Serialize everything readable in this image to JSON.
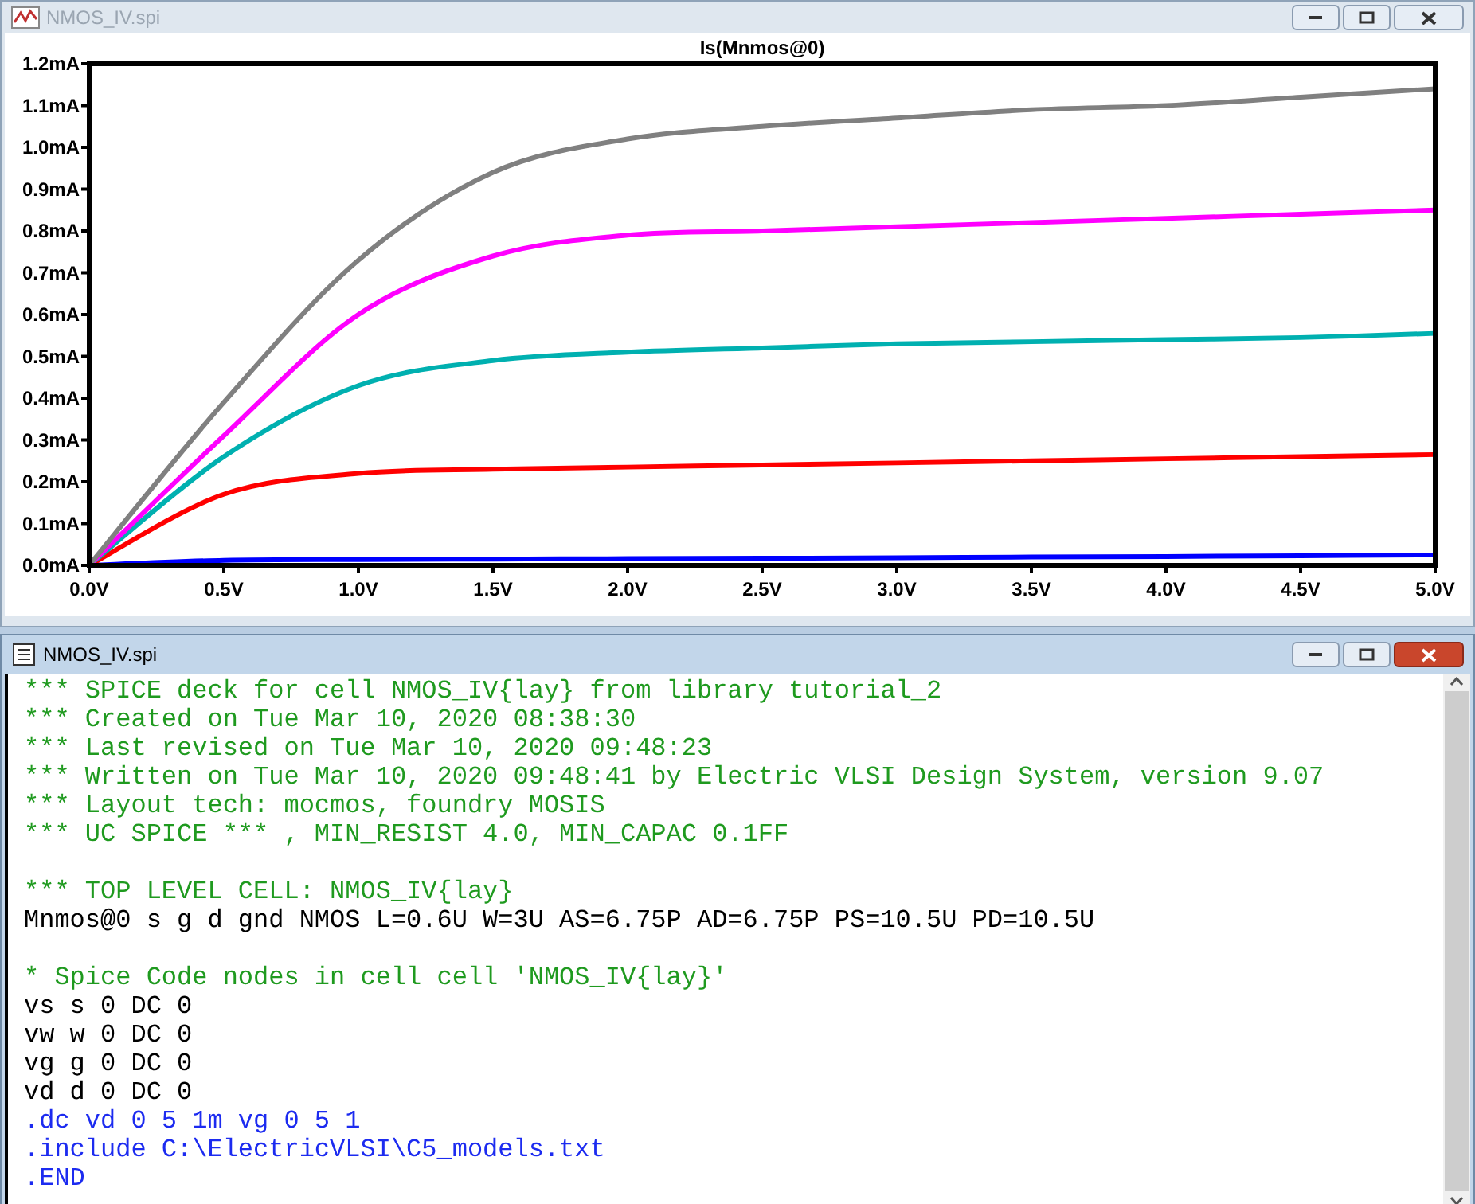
{
  "plot_window": {
    "title": "NMOS_IV.spi",
    "active": false,
    "chart_data": {
      "type": "line",
      "title": "Is(Mnmos@0)",
      "x": [
        0,
        0.5,
        1,
        1.5,
        2,
        2.5,
        3,
        3.5,
        4,
        4.5,
        5
      ],
      "xlim": [
        0,
        5
      ],
      "ylim": [
        0,
        1.2
      ],
      "xticks": [
        {
          "value": 0,
          "label": "0.0V"
        },
        {
          "value": 0.5,
          "label": "0.5V"
        },
        {
          "value": 1,
          "label": "1.0V"
        },
        {
          "value": 1.5,
          "label": "1.5V"
        },
        {
          "value": 2,
          "label": "2.0V"
        },
        {
          "value": 2.5,
          "label": "2.5V"
        },
        {
          "value": 3,
          "label": "3.0V"
        },
        {
          "value": 3.5,
          "label": "3.5V"
        },
        {
          "value": 4,
          "label": "4.0V"
        },
        {
          "value": 4.5,
          "label": "4.5V"
        },
        {
          "value": 5,
          "label": "5.0V"
        }
      ],
      "yticks": [
        {
          "value": 0,
          "label": "0.0mA"
        },
        {
          "value": 0.1,
          "label": "0.1mA"
        },
        {
          "value": 0.2,
          "label": "0.2mA"
        },
        {
          "value": 0.3,
          "label": "0.3mA"
        },
        {
          "value": 0.4,
          "label": "0.4mA"
        },
        {
          "value": 0.5,
          "label": "0.5mA"
        },
        {
          "value": 0.6,
          "label": "0.6mA"
        },
        {
          "value": 0.7,
          "label": "0.7mA"
        },
        {
          "value": 0.8,
          "label": "0.8mA"
        },
        {
          "value": 0.9,
          "label": "0.9mA"
        },
        {
          "value": 1.0,
          "label": "1.0mA"
        },
        {
          "value": 1.1,
          "label": "1.1mA"
        },
        {
          "value": 1.2,
          "label": "1.2mA"
        }
      ],
      "series": [
        {
          "color": "#0000ff",
          "values": [
            0,
            0.012,
            0.014,
            0.015,
            0.016,
            0.017,
            0.018,
            0.02,
            0.021,
            0.023,
            0.025
          ]
        },
        {
          "color": "#ff0000",
          "values": [
            0,
            0.17,
            0.22,
            0.23,
            0.235,
            0.24,
            0.245,
            0.25,
            0.255,
            0.26,
            0.265
          ]
        },
        {
          "color": "#00b0b0",
          "values": [
            0,
            0.26,
            0.43,
            0.49,
            0.51,
            0.52,
            0.53,
            0.535,
            0.54,
            0.545,
            0.555
          ]
        },
        {
          "color": "#ff00ff",
          "values": [
            0,
            0.31,
            0.6,
            0.74,
            0.79,
            0.8,
            0.81,
            0.82,
            0.83,
            0.84,
            0.85
          ]
        },
        {
          "color": "#808080",
          "values": [
            0,
            0.39,
            0.73,
            0.94,
            1.02,
            1.05,
            1.07,
            1.09,
            1.1,
            1.12,
            1.14
          ]
        }
      ]
    }
  },
  "text_window": {
    "title": "NMOS_IV.spi",
    "active": true,
    "lines": [
      {
        "kind": "comment",
        "text": "*** SPICE deck for cell NMOS_IV{lay} from library tutorial_2"
      },
      {
        "kind": "comment",
        "text": "*** Created on Tue Mar 10, 2020 08:38:30"
      },
      {
        "kind": "comment",
        "text": "*** Last revised on Tue Mar 10, 2020 09:48:23"
      },
      {
        "kind": "comment",
        "text": "*** Written on Tue Mar 10, 2020 09:48:41 by Electric VLSI Design System, version 9.07"
      },
      {
        "kind": "comment",
        "text": "*** Layout tech: mocmos, foundry MOSIS"
      },
      {
        "kind": "comment",
        "text": "*** UC SPICE *** , MIN_RESIST 4.0, MIN_CAPAC 0.1FF"
      },
      {
        "kind": "blank"
      },
      {
        "kind": "comment",
        "text": "*** TOP LEVEL CELL: NMOS_IV{lay}"
      },
      {
        "kind": "netlist",
        "text": "Mnmos@0 s g d gnd NMOS L=0.6U W=3U AS=6.75P AD=6.75P PS=10.5U PD=10.5U"
      },
      {
        "kind": "blank"
      },
      {
        "kind": "comment",
        "text": "* Spice Code nodes in cell cell 'NMOS_IV{lay}'"
      },
      {
        "kind": "netlist",
        "text": "vs s 0 DC 0"
      },
      {
        "kind": "netlist",
        "text": "vw w 0 DC 0"
      },
      {
        "kind": "netlist",
        "text": "vg g 0 DC 0"
      },
      {
        "kind": "netlist",
        "text": "vd d 0 DC 0"
      },
      {
        "kind": "command",
        "text": ".dc vd 0 5 1m vg 0 5 1"
      },
      {
        "kind": "command",
        "text": ".include C:\\ElectricVLSI\\C5_models.txt"
      },
      {
        "kind": "command",
        "text": ".END"
      }
    ]
  }
}
